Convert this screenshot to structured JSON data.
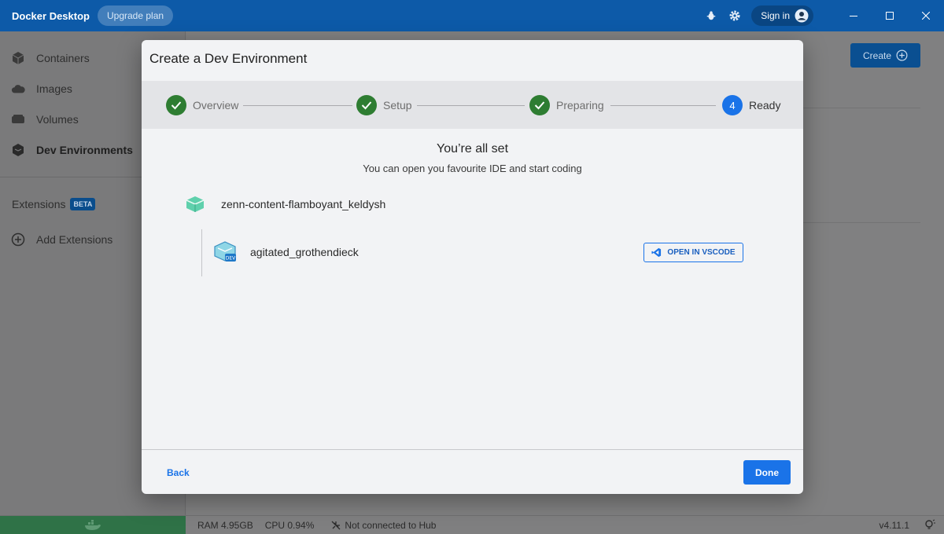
{
  "window": {
    "app_title": "Docker Desktop",
    "upgrade_label": "Upgrade plan",
    "signin_label": "Sign in"
  },
  "sidebar": {
    "items": [
      {
        "label": "Containers",
        "icon": "container-icon"
      },
      {
        "label": "Images",
        "icon": "cloud-icon"
      },
      {
        "label": "Volumes",
        "icon": "volume-icon"
      },
      {
        "label": "Dev Environments",
        "icon": "dev-env-icon"
      }
    ],
    "extensions_label": "Extensions",
    "beta_label": "BETA",
    "add_extensions_label": "Add Extensions"
  },
  "main": {
    "create_label": "Create"
  },
  "modal": {
    "title": "Create a Dev Environment",
    "steps": [
      {
        "label": "Overview",
        "state": "done"
      },
      {
        "label": "Setup",
        "state": "done"
      },
      {
        "label": "Preparing",
        "state": "done"
      },
      {
        "label": "Ready",
        "state": "current",
        "number": "4"
      }
    ],
    "heading": "You’re all set",
    "subheading": "You can open you favourite IDE and start coding",
    "environment_name": "zenn-content-flamboyant_keldysh",
    "container_name": "agitated_grothendieck",
    "open_vscode_label": "OPEN IN VSCODE",
    "back_label": "Back",
    "done_label": "Done"
  },
  "statusbar": {
    "ram": "RAM 4.95GB",
    "cpu": "CPU 0.94%",
    "hub_status": "Not connected to Hub",
    "version": "v4.11.1"
  },
  "colors": {
    "titlebar": "#0d5aa8",
    "accent": "#1a73e8",
    "step_done": "#2e7d32",
    "env_icon": "#4fc3a1"
  }
}
